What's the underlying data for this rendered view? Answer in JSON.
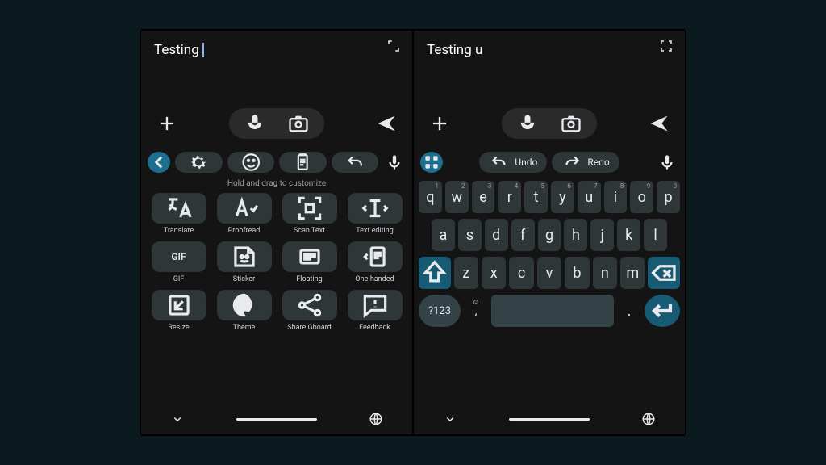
{
  "left": {
    "text_value": "Testing",
    "toolbar_icons": [
      "back",
      "gear",
      "emoji",
      "clipboard",
      "undo",
      "mic"
    ],
    "hint": "Hold and drag to customize",
    "tools": [
      {
        "icon": "translate",
        "label": "Translate"
      },
      {
        "icon": "proofread",
        "label": "Proofread"
      },
      {
        "icon": "scan",
        "label": "Scan Text"
      },
      {
        "icon": "textedit",
        "label": "Text editing"
      },
      {
        "icon": "gif",
        "label": "GIF"
      },
      {
        "icon": "sticker",
        "label": "Sticker"
      },
      {
        "icon": "floating",
        "label": "Floating"
      },
      {
        "icon": "onehanded",
        "label": "One-handed"
      },
      {
        "icon": "resize",
        "label": "Resize"
      },
      {
        "icon": "theme",
        "label": "Theme"
      },
      {
        "icon": "share",
        "label": "Share Gboard"
      },
      {
        "icon": "feedback",
        "label": "Feedback"
      }
    ]
  },
  "right": {
    "text_value": "Testing u",
    "chips": {
      "undo": "Undo",
      "redo": "Redo"
    },
    "rows": {
      "r1": [
        {
          "k": "q",
          "n": "1"
        },
        {
          "k": "w",
          "n": "2"
        },
        {
          "k": "e",
          "n": "3"
        },
        {
          "k": "r",
          "n": "4"
        },
        {
          "k": "t",
          "n": "5"
        },
        {
          "k": "y",
          "n": "6"
        },
        {
          "k": "u",
          "n": "7"
        },
        {
          "k": "i",
          "n": "8"
        },
        {
          "k": "o",
          "n": "9"
        },
        {
          "k": "p",
          "n": "0"
        }
      ],
      "r2": [
        "a",
        "s",
        "d",
        "f",
        "g",
        "h",
        "j",
        "k",
        "l"
      ],
      "r3": [
        "z",
        "x",
        "c",
        "v",
        "b",
        "n",
        "m"
      ]
    },
    "sym_label": "?123",
    "comma": ",",
    "period": "."
  },
  "gif_text": "GIF"
}
